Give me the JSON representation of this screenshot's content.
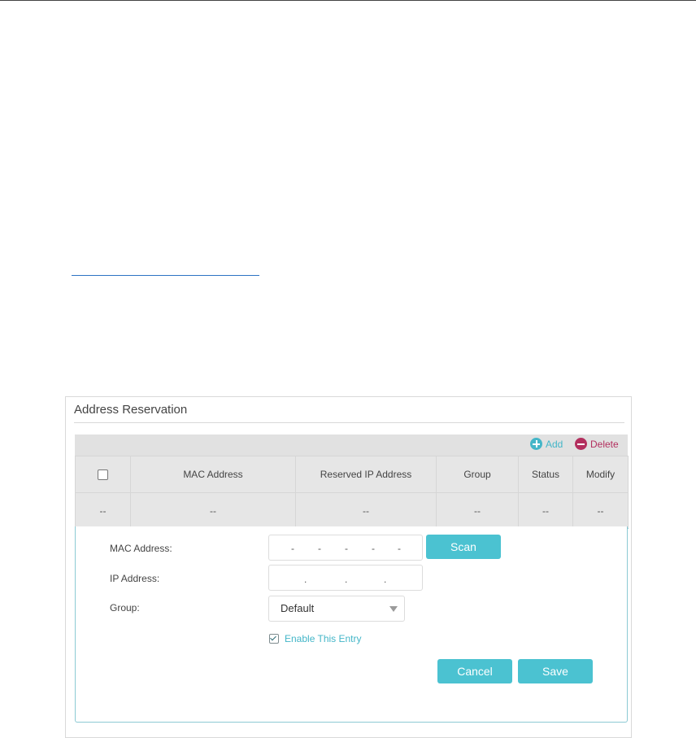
{
  "panel": {
    "title": "Address Reservation"
  },
  "toolbar": {
    "add_label": "Add",
    "delete_label": "Delete"
  },
  "table": {
    "columns": [
      "MAC Address",
      "Reserved IP Address",
      "Group",
      "Status",
      "Modify"
    ],
    "rows": [
      {
        "mac": "--",
        "ip": "--",
        "group": "--",
        "status": "--",
        "modify": "--",
        "select": "--"
      }
    ]
  },
  "form": {
    "mac_label": "MAC Address:",
    "ip_label": "IP Address:",
    "group_label": "Group:",
    "mac_separator": "-",
    "ip_separator": ".",
    "scan_label": "Scan",
    "group_value": "Default",
    "enable_label": "Enable This Entry",
    "enable_checked": true,
    "cancel_label": "Cancel",
    "save_label": "Save"
  },
  "colors": {
    "accent": "#4bc2d1",
    "delete": "#b32f5e",
    "link": "#2d74c4"
  },
  "icons": {
    "add": "plus-circle-icon",
    "delete": "minus-circle-icon",
    "dropdown": "caret-down-icon"
  }
}
